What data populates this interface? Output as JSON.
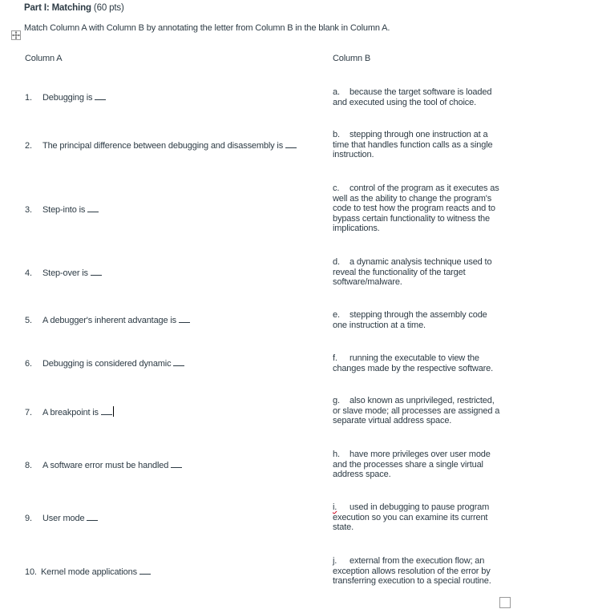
{
  "header": {
    "part_label": "Part I: Matching",
    "points": "(60 pts)",
    "instructions": "Match Column A with Column B by annotating the letter from Column B in the blank in Column A."
  },
  "icons": {
    "table_move_handle": "move-arrows-icon",
    "table_resize_handle": "resize-box-icon"
  },
  "column_a": {
    "header": "Column A",
    "items": [
      {
        "number": "1.",
        "text": "Debugging is",
        "blank": "___"
      },
      {
        "number": "2.",
        "text": "The principal difference between debugging and disassembly is",
        "blank": "___"
      },
      {
        "number": "3.",
        "text": "Step-into is",
        "blank": "___"
      },
      {
        "number": "4.",
        "text": "Step-over is",
        "blank": "___"
      },
      {
        "number": "5.",
        "text": "A debugger's inherent advantage is",
        "blank": "___"
      },
      {
        "number": "6.",
        "text": "Debugging is considered dynamic",
        "blank": "___"
      },
      {
        "number": "7.",
        "text": "A breakpoint is",
        "blank": "___"
      },
      {
        "number": "8.",
        "text": "A software error must be handled",
        "blank": "___"
      },
      {
        "number": "9.",
        "text": "User mode",
        "blank": "___"
      },
      {
        "number": "10.",
        "text": "Kernel mode applications",
        "blank": "___"
      }
    ]
  },
  "column_b": {
    "header": "Column B",
    "items": [
      {
        "letter": "a.",
        "text": "because the target software is loaded and executed using the tool of choice."
      },
      {
        "letter": "b.",
        "text": "stepping through one instruction at a time that handles function calls as a single instruction."
      },
      {
        "letter": "c.",
        "text": "control of the program as it executes as well as the ability to change the program's code to test how the program reacts and to bypass certain functionality to witness the implications."
      },
      {
        "letter": "d.",
        "text": "a dynamic analysis technique used to reveal the functionality of the target software/malware."
      },
      {
        "letter": "e.",
        "text": "stepping through the assembly code one instruction at a time."
      },
      {
        "letter": "f.",
        "text": "running the executable to view the changes made by the respective software."
      },
      {
        "letter": "g.",
        "text": "also known as unprivileged, restricted, or slave mode; all processes are assigned a separate virtual address space."
      },
      {
        "letter": "h.",
        "text": "have more privileges over user mode and the processes share a single virtual address space."
      },
      {
        "letter": "i.",
        "text": "used in debugging to pause program execution so you can examine its current state."
      },
      {
        "letter": "j.",
        "text": "external from the execution flow; an exception allows resolution of the error by transferring execution to a special routine."
      }
    ]
  }
}
